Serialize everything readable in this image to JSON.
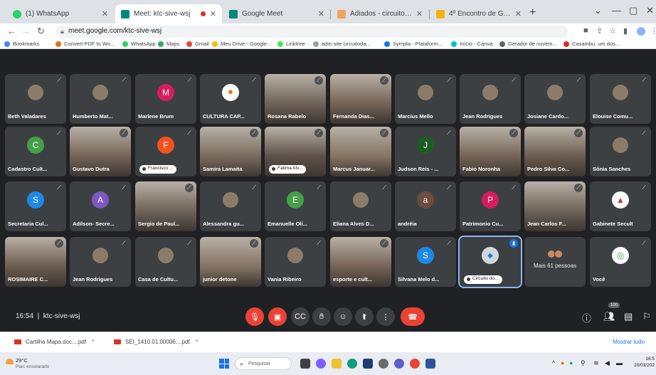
{
  "browser": {
    "tabs": [
      {
        "title": "(1) WhatsApp",
        "color": "#25d366",
        "active": false
      },
      {
        "title": "Meet: ktc-sive-wsj",
        "color": "#00897b",
        "active": true,
        "recording": true
      },
      {
        "title": "Google Meet",
        "color": "#00897b",
        "active": false
      },
      {
        "title": "Adiados - circuitodasaguas.gest...",
        "color": "#f0a35e",
        "active": false
      },
      {
        "title": "4º Encontro de Gestores Municip...",
        "color": "#f4b400",
        "active": false
      }
    ],
    "url": "meet.google.com/ktc-sive-wsj",
    "bookmarks": [
      {
        "label": "Bookmarks",
        "color": "#4285f4"
      },
      {
        "label": "Convert PDF to Wo...",
        "color": "#e8710a"
      },
      {
        "label": "WhatsApp",
        "color": "#25d366"
      },
      {
        "label": "Maps",
        "color": "#34a853"
      },
      {
        "label": "Gmail",
        "color": "#ea4335"
      },
      {
        "label": "Meu Drive - Google...",
        "color": "#fbbc04"
      },
      {
        "label": "Linktree",
        "color": "#43e660"
      },
      {
        "label": "adm site circuitoda...",
        "color": "#9aa0a6"
      },
      {
        "label": "Sympla - Plataform...",
        "color": "#1a73e8"
      },
      {
        "label": "Início - Canva",
        "color": "#00c4cc"
      },
      {
        "label": "Gerador de nuvem...",
        "color": "#5f6368"
      },
      {
        "label": "Caxambu: um dos...",
        "color": "#d93025"
      }
    ]
  },
  "meet": {
    "tiles": [
      {
        "name": "Beth Valadares",
        "kind": "pic"
      },
      {
        "name": "Humberto Mat...",
        "kind": "pic"
      },
      {
        "name": "Marlene Brum",
        "kind": "letter",
        "letter": "M",
        "color": "#d81b60"
      },
      {
        "name": "CULTURA CAP...",
        "kind": "logo"
      },
      {
        "name": "Rosana Rabelo",
        "kind": "photo"
      },
      {
        "name": "Fernanda Dias...",
        "kind": "photo"
      },
      {
        "name": "Marcius Mello",
        "kind": "pic"
      },
      {
        "name": "Jean Rodrigues",
        "kind": "pic"
      },
      {
        "name": "Josiane Cardo...",
        "kind": "pic"
      },
      {
        "name": "Elouise Comu...",
        "kind": "pic"
      },
      {
        "name": "Cadastro Cult...",
        "kind": "letter",
        "letter": "C",
        "color": "#43a047"
      },
      {
        "name": "Gustavo Dutra",
        "kind": "photo"
      },
      {
        "name": "Francisco ...",
        "kind": "letter-chip",
        "letter": "F",
        "color": "#f4511e"
      },
      {
        "name": "Samira Lamaita",
        "kind": "photo"
      },
      {
        "name": "Fatima Alv...",
        "kind": "photo-chip"
      },
      {
        "name": "Marcus Januar...",
        "kind": "photo"
      },
      {
        "name": "Judson Reis - ...",
        "kind": "letter",
        "letter": "J",
        "color": "#1b5e20"
      },
      {
        "name": "Fabio Noronha",
        "kind": "photo"
      },
      {
        "name": "Pedro Silva Co...",
        "kind": "photo"
      },
      {
        "name": "Sônia Sanches",
        "kind": "pic"
      },
      {
        "name": "Secretaria Cul...",
        "kind": "letter",
        "letter": "S",
        "color": "#1e88e5"
      },
      {
        "name": "Adilson- Secre...",
        "kind": "letter",
        "letter": "A",
        "color": "#7e57c2"
      },
      {
        "name": "Sergio de Paul...",
        "kind": "photo"
      },
      {
        "name": "Alessandra gu...",
        "kind": "pic"
      },
      {
        "name": "Emanuelle Oli...",
        "kind": "letter",
        "letter": "E",
        "color": "#43a047"
      },
      {
        "name": "Eliana Alves D...",
        "kind": "pic"
      },
      {
        "name": "andréia",
        "kind": "letter",
        "letter": "a",
        "color": "#6d4c41"
      },
      {
        "name": "Patrimonio Cu...",
        "kind": "letter",
        "letter": "P",
        "color": "#d81b60"
      },
      {
        "name": "Jean Carlos F...",
        "kind": "photo"
      },
      {
        "name": "Gabinete Secult",
        "kind": "logo-red"
      },
      {
        "name": "ROSIMAIRE C...",
        "kind": "photo"
      },
      {
        "name": "Jean Rodrigues",
        "kind": "pic"
      },
      {
        "name": "Casa de Cultu...",
        "kind": "pic"
      },
      {
        "name": "junior detone",
        "kind": "photo"
      },
      {
        "name": "Vania Ribeiro",
        "kind": "pic"
      },
      {
        "name": "esporte e cult...",
        "kind": "photo"
      },
      {
        "name": "Silvana Melo d...",
        "kind": "letter",
        "letter": "S",
        "color": "#1e88e5"
      },
      {
        "name": "Circuito do...",
        "kind": "speaker"
      },
      {
        "name": "Mais 61 pessoas",
        "kind": "more"
      },
      {
        "name": "Você",
        "kind": "self"
      }
    ],
    "time": "16:54",
    "separator": "|",
    "meeting_code": "ktc-sive-wsj",
    "participants_badge": "100"
  },
  "downloads": {
    "files": [
      {
        "name": "Cartilha Mapa.doc....pdf"
      },
      {
        "name": "SEI_1410.01.00006....pdf"
      }
    ],
    "show_all": "Mostrar tudo"
  },
  "taskbar": {
    "temperature": "29°C",
    "weather": "Parc ensolarado",
    "search_placeholder": "Pesquisar",
    "time": "16:5",
    "date": "20/03/202"
  }
}
